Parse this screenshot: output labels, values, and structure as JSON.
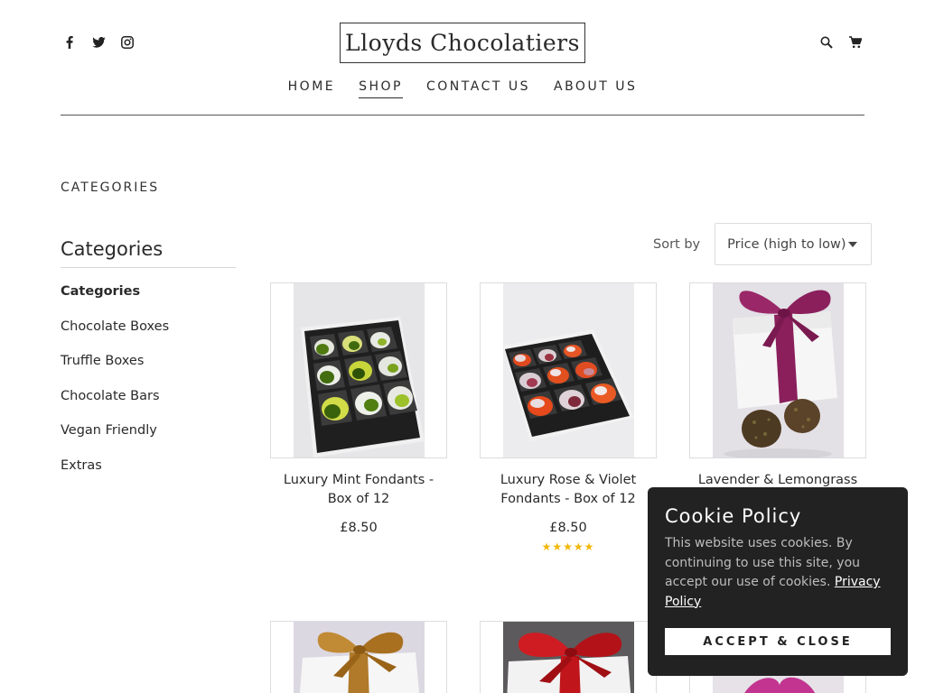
{
  "header": {
    "logo_text": "Lloyds Chocolatiers",
    "social_icons": [
      "facebook-icon",
      "twitter-icon",
      "instagram-icon"
    ],
    "right_icons": [
      "search-icon",
      "cart-icon"
    ]
  },
  "nav": {
    "items": [
      {
        "label": "HOME",
        "active": false
      },
      {
        "label": "SHOP",
        "active": true
      },
      {
        "label": "CONTACT US",
        "active": false
      },
      {
        "label": "ABOUT US",
        "active": false
      }
    ]
  },
  "page": {
    "heading": "CATEGORIES"
  },
  "sidebar": {
    "title": "Categories",
    "items": [
      {
        "label": "Categories",
        "bold": true
      },
      {
        "label": "Chocolate Boxes",
        "bold": false
      },
      {
        "label": "Truffle Boxes",
        "bold": false
      },
      {
        "label": "Chocolate Bars",
        "bold": false
      },
      {
        "label": "Vegan Friendly",
        "bold": false
      },
      {
        "label": "Extras",
        "bold": false
      }
    ]
  },
  "sort": {
    "label": "Sort by",
    "selected": "Price (high to low)"
  },
  "products": [
    {
      "name": "Luxury Mint Fondants - Box of 12",
      "price": "£8.50",
      "rating": 0
    },
    {
      "name": "Luxury Rose & Violet Fondants - Box of 12",
      "price": "£8.50",
      "rating": 5,
      "stars": "★★★★★"
    },
    {
      "name": "Lavender & Lemongrass Gin",
      "price": "",
      "rating": 0
    }
  ],
  "cookie": {
    "title": "Cookie Policy",
    "body": "This website uses cookies. By continuing to use this site, you accept our use of cookies.",
    "link": "Privacy Policy",
    "button": "ACCEPT & CLOSE"
  },
  "colors": {
    "text": "#2a2a2a",
    "cookie_bg": "#222222",
    "star": "#f2b705",
    "ribbon_purple": "#8a1f5c",
    "ribbon_gold": "#b07a2a",
    "ribbon_red": "#c0161b"
  }
}
